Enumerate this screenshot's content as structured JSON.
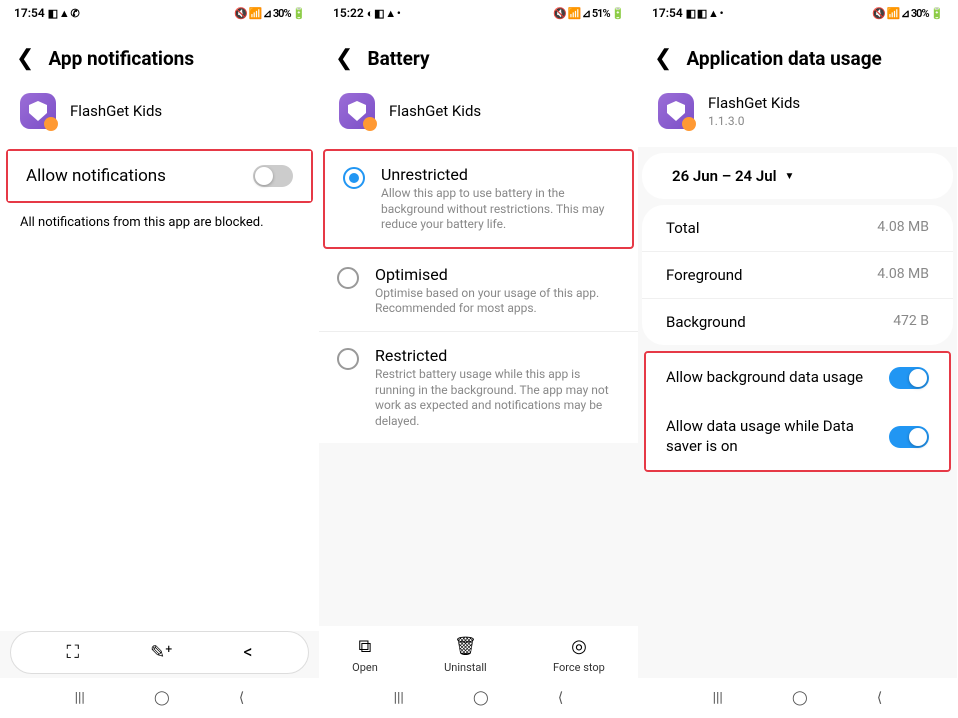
{
  "screens": [
    {
      "status": {
        "time": "17:54",
        "leftIcons": "◧ ▲ ✆",
        "rightIcons": "🔇 📶 ⊿ 30% 🔋"
      },
      "title": "App notifications",
      "app": {
        "name": "FlashGet Kids"
      },
      "toggle": {
        "label": "Allow notifications",
        "on": false
      },
      "hint": "All notifications from this app are blocked."
    },
    {
      "status": {
        "time": "15:22",
        "leftIcons": "◐ ◧ ▲ •",
        "rightIcons": "🔇 📶 ⊿ 51% 🔋"
      },
      "title": "Battery",
      "app": {
        "name": "FlashGet Kids"
      },
      "options": [
        {
          "title": "Unrestricted",
          "desc": "Allow this app to use battery in the background without restrictions. This may reduce your battery life.",
          "selected": true
        },
        {
          "title": "Optimised",
          "desc": "Optimise based on your usage of this app. Recommended for most apps.",
          "selected": false
        },
        {
          "title": "Restricted",
          "desc": "Restrict battery usage while this app is running in the background. The app may not work as expected and notifications may be delayed.",
          "selected": false
        }
      ],
      "bottom": [
        {
          "icon": "↗",
          "label": "Open"
        },
        {
          "icon": "🗑",
          "label": "Uninstall"
        },
        {
          "icon": "◎",
          "label": "Force stop"
        }
      ]
    },
    {
      "status": {
        "time": "17:54",
        "leftIcons": "◧ ◧ ▲ •",
        "rightIcons": "🔇 📶 ⊿ 30% 🔋"
      },
      "title": "Application data usage",
      "app": {
        "name": "FlashGet Kids",
        "version": "1.1.3.0"
      },
      "dateRange": "26 Jun – 24 Jul",
      "usage": [
        {
          "label": "Total",
          "value": "4.08 MB"
        },
        {
          "label": "Foreground",
          "value": "4.08 MB"
        },
        {
          "label": "Background",
          "value": "472 B"
        }
      ],
      "toggles": [
        {
          "label": "Allow background data usage",
          "on": true
        },
        {
          "label": "Allow data usage while Data saver is on",
          "on": true
        }
      ]
    }
  ],
  "nav": {
    "recent": "|||",
    "home": "◯",
    "back": "⟨"
  }
}
